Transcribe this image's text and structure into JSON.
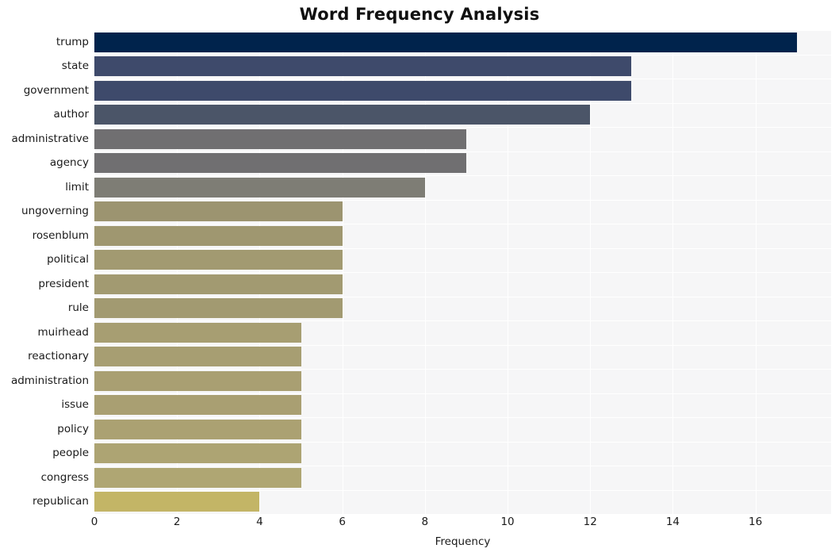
{
  "chart_data": {
    "type": "bar",
    "orientation": "horizontal",
    "title": "Word Frequency Analysis",
    "xlabel": "Frequency",
    "ylabel": "",
    "categories": [
      "trump",
      "state",
      "government",
      "author",
      "administrative",
      "agency",
      "limit",
      "ungoverning",
      "rosenblum",
      "political",
      "president",
      "rule",
      "muirhead",
      "reactionary",
      "administration",
      "issue",
      "policy",
      "people",
      "congress",
      "republican"
    ],
    "values": [
      17,
      13,
      13,
      12,
      9,
      9,
      8,
      6,
      6,
      6,
      6,
      6,
      5,
      5,
      5,
      5,
      5,
      5,
      5,
      4
    ],
    "bar_colors": [
      "#00234c",
      "#3e4a6b",
      "#3e4a6b",
      "#4b5568",
      "#706f71",
      "#706f71",
      "#7e7d75",
      "#9c9470",
      "#9f9770",
      "#a29a71",
      "#a29a71",
      "#a29a71",
      "#a79e72",
      "#a79e72",
      "#a99f72",
      "#a99f72",
      "#aba172",
      "#ada473",
      "#afa673",
      "#c3b566"
    ],
    "xticks": [
      0,
      2,
      4,
      6,
      8,
      10,
      12,
      14,
      16
    ],
    "xtick_labels": [
      "0",
      "2",
      "4",
      "6",
      "8",
      "10",
      "12",
      "14",
      "16"
    ],
    "xlim": [
      0,
      17.83
    ],
    "grid": true,
    "grid_color": "#ffffff",
    "plot_background": "#f6f6f7",
    "figure_background": "#ffffff",
    "legend": null
  }
}
